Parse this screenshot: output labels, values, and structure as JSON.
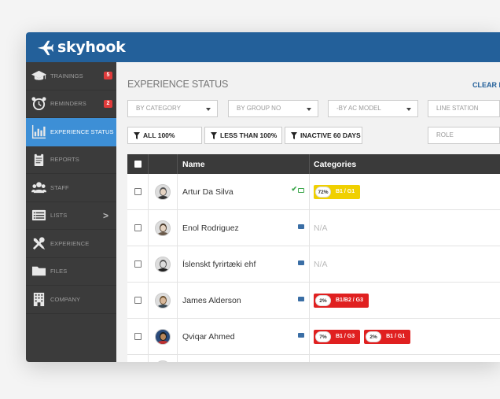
{
  "app": {
    "brand": "skyhook"
  },
  "sidebar": {
    "items": [
      {
        "label": "TRAININGS",
        "icon": "graduation-cap-icon",
        "badge": "5"
      },
      {
        "label": "REMINDERS",
        "icon": "alarm-clock-icon",
        "badge": "2"
      },
      {
        "label": "EXPERIENCE STATUS",
        "icon": "bar-chart-icon",
        "active": true
      },
      {
        "label": "REPORTS",
        "icon": "clipboard-icon"
      },
      {
        "label": "STAFF",
        "icon": "users-icon"
      },
      {
        "label": "LISTS",
        "icon": "list-icon",
        "chevron": ">"
      },
      {
        "label": "EXPERIENCE",
        "icon": "tools-icon"
      },
      {
        "label": "FILES",
        "icon": "folder-icon"
      },
      {
        "label": "COMPANY",
        "icon": "building-icon"
      }
    ]
  },
  "main": {
    "title": "EXPERIENCE STATUS",
    "clear_filters": "CLEAR FI",
    "filters": [
      {
        "placeholder": "BY CATEGORY"
      },
      {
        "placeholder": "BY GROUP NO"
      },
      {
        "placeholder": "-BY AC MODEL"
      },
      {
        "placeholder": "LINE STATION"
      }
    ],
    "role_placeholder": "ROLE",
    "quick_filters": [
      "ALL 100%",
      "LESS THAN 100%",
      "INACTIVE 60 DAYS"
    ]
  },
  "table": {
    "columns": [
      "Name",
      "Categories"
    ],
    "rows": [
      {
        "name": "Artur Da Silva",
        "categories": [
          {
            "pct": "72%",
            "label": "B1 / G1",
            "color": "#f0d000"
          }
        ]
      },
      {
        "name": "Enol Rodriguez",
        "na": "N/A"
      },
      {
        "name": "Íslenskt fyrirtæki ehf",
        "na": "N/A"
      },
      {
        "name": "James Alderson",
        "categories": [
          {
            "pct": "2%",
            "label": "B1/B2 / G3",
            "color": "#e02020"
          }
        ]
      },
      {
        "name": "Qviqar Ahmed",
        "categories": [
          {
            "pct": "7%",
            "label": "B1 / G3",
            "color": "#e02020"
          },
          {
            "pct": "2%",
            "label": "B1 / G1",
            "color": "#e02020"
          }
        ]
      }
    ]
  },
  "colors": {
    "topbar": "#23609a",
    "sidebar": "#3b3b3b",
    "active": "#3d8fd6",
    "badge": "#e03b3b"
  }
}
